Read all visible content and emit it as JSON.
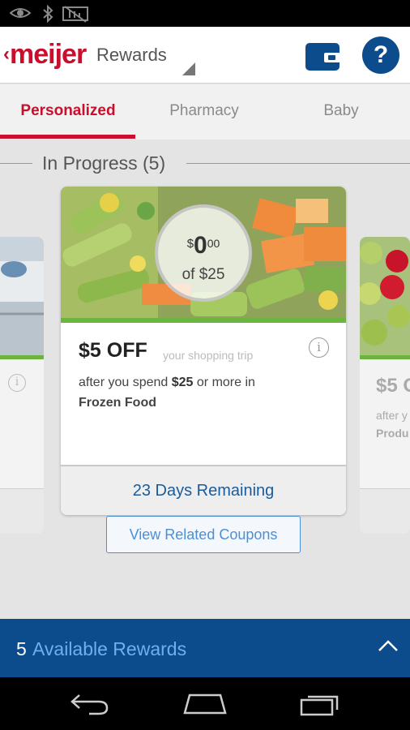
{
  "status_bar": {
    "icons": [
      "eye-icon",
      "bluetooth-icon",
      "no-signal-icon"
    ]
  },
  "header": {
    "logo_text": "meijer",
    "title": "Rewards",
    "icons": [
      "wallet-icon",
      "help-icon"
    ],
    "help_label": "?"
  },
  "tabs": [
    {
      "label": "Personalized",
      "active": true
    },
    {
      "label": "Pharmacy",
      "active": false
    },
    {
      "label": "Baby",
      "active": false
    }
  ],
  "section": {
    "title": "In Progress (5)"
  },
  "main_card": {
    "progress": {
      "currency": "$",
      "dollars": "0",
      "cents": "00",
      "of_label": "of $25"
    },
    "offer": "$5 OFF",
    "offer_sub": "your shopping trip",
    "desc_pre": "after you spend ",
    "desc_amount": "$25",
    "desc_post": " or more in",
    "category": "Frozen Food",
    "footer": "23 Days Remaining"
  },
  "side_right": {
    "amount": "$5 O",
    "line1": "after y",
    "line2": "Produ"
  },
  "related_button": "View Related Coupons",
  "bottom_bar": {
    "count": "5",
    "label": "Available Rewards"
  },
  "colors": {
    "brand_red": "#c8102e",
    "brand_blue": "#0c4c8c",
    "link_blue": "#4a90d9",
    "progress_green": "#6cb33f"
  }
}
